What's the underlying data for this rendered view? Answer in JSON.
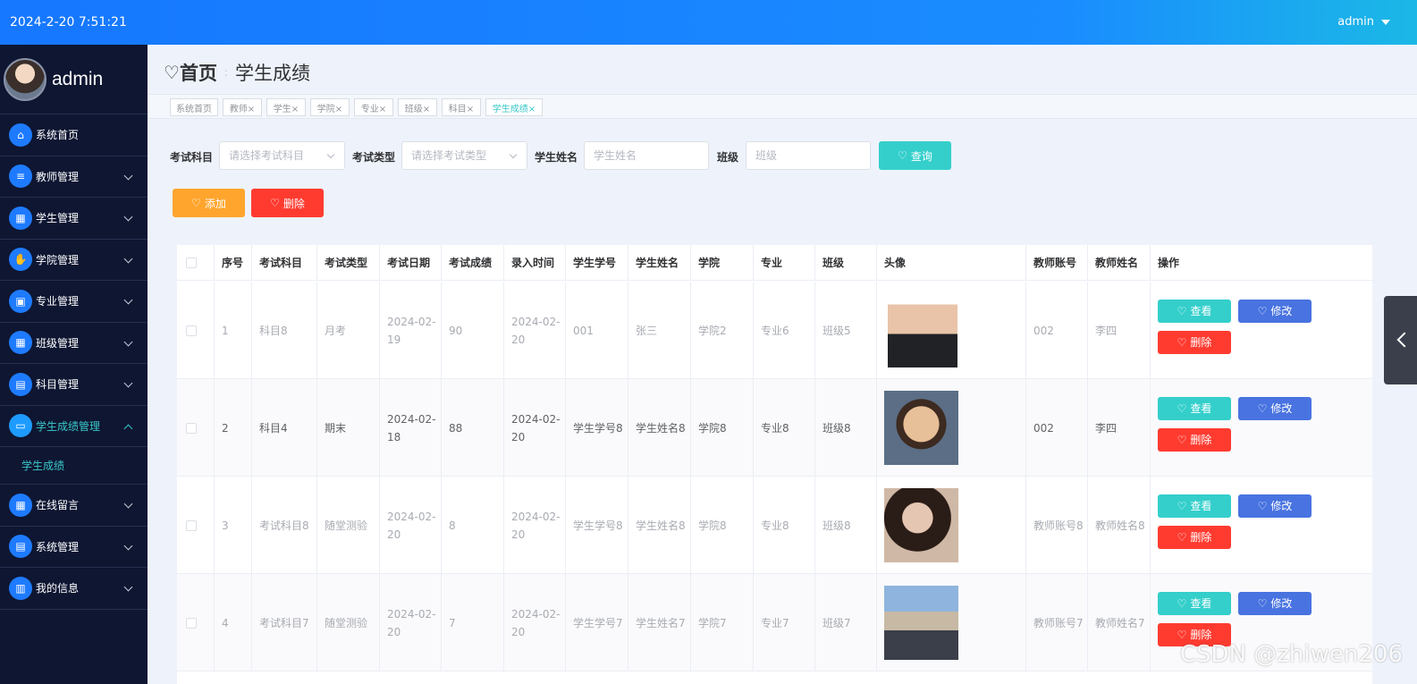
{
  "header": {
    "datetime": "2024-2-20 7:51:21",
    "user": "admin"
  },
  "sidebar": {
    "username": "admin",
    "items": [
      {
        "label": "系统首页",
        "icon": "home-icon",
        "glyph": "⌂"
      },
      {
        "label": "教师管理",
        "icon": "sliders-icon",
        "glyph": "≡"
      },
      {
        "label": "学生管理",
        "icon": "grid-icon",
        "glyph": "▦"
      },
      {
        "label": "学院管理",
        "icon": "thumb-icon",
        "glyph": "✋"
      },
      {
        "label": "专业管理",
        "icon": "badge-icon",
        "glyph": "▣"
      },
      {
        "label": "班级管理",
        "icon": "grid-icon",
        "glyph": "▦"
      },
      {
        "label": "科目管理",
        "icon": "clipboard-icon",
        "glyph": "▤"
      },
      {
        "label": "学生成绩管理",
        "icon": "monitor-icon",
        "glyph": "▭"
      },
      {
        "label": "在线留言",
        "icon": "grid-icon",
        "glyph": "▦"
      },
      {
        "label": "系统管理",
        "icon": "clipboard-icon",
        "glyph": "▤"
      },
      {
        "label": "我的信息",
        "icon": "card-icon",
        "glyph": "▥"
      }
    ],
    "submenu": "学生成绩"
  },
  "breadcrumb": {
    "home": "首页",
    "current": "学生成绩"
  },
  "tags": [
    "系统首页",
    "教师×",
    "学生×",
    "学院×",
    "专业×",
    "班级×",
    "科目×",
    "学生成绩×"
  ],
  "filters": {
    "subject_label": "考试科目",
    "subject_placeholder": "请选择考试科目",
    "type_label": "考试类型",
    "type_placeholder": "请选择考试类型",
    "name_label": "学生姓名",
    "name_placeholder": "学生姓名",
    "class_label": "班级",
    "class_placeholder": "班级",
    "query": "查询"
  },
  "actions": {
    "add": "添加",
    "delete": "删除"
  },
  "table": {
    "columns": [
      "序号",
      "考试科目",
      "考试类型",
      "考试日期",
      "考试成绩",
      "录入时间",
      "学生学号",
      "学生姓名",
      "学院",
      "专业",
      "班级",
      "头像",
      "教师账号",
      "教师姓名",
      "操作"
    ],
    "rows": [
      {
        "no": "1",
        "subject": "科目8",
        "type": "月考",
        "date": "2024-02-19",
        "score": "90",
        "entry": "2024-02-20",
        "sid": "001",
        "sname": "张三",
        "college": "学院2",
        "major": "专业6",
        "cls": "班级5",
        "tid": "002",
        "tname": "李四"
      },
      {
        "no": "2",
        "subject": "科目4",
        "type": "期末",
        "date": "2024-02-18",
        "score": "88",
        "entry": "2024-02-20",
        "sid": "学生学号8",
        "sname": "学生姓名8",
        "college": "学院8",
        "major": "专业8",
        "cls": "班级8",
        "tid": "002",
        "tname": "李四"
      },
      {
        "no": "3",
        "subject": "考试科目8",
        "type": "随堂测验",
        "date": "2024-02-20",
        "score": "8",
        "entry": "2024-02-20",
        "sid": "学生学号8",
        "sname": "学生姓名8",
        "college": "学院8",
        "major": "专业8",
        "cls": "班级8",
        "tid": "教师账号8",
        "tname": "教师姓名8"
      },
      {
        "no": "4",
        "subject": "考试科目7",
        "type": "随堂测验",
        "date": "2024-02-20",
        "score": "7",
        "entry": "2024-02-20",
        "sid": "学生学号7",
        "sname": "学生姓名7",
        "college": "学院7",
        "major": "专业7",
        "cls": "班级7",
        "tid": "教师账号7",
        "tname": "教师姓名7"
      }
    ],
    "ops": {
      "view": "查看",
      "edit": "修改",
      "delete": "删除"
    }
  },
  "watermark": "CSDN @zhiwen206",
  "colors": {
    "primary": "#1677ff",
    "teal": "#34cfcb",
    "orange": "#ffa52e",
    "red": "#ff3b30",
    "blue": "#4873e0",
    "sidebar": "#0e1632"
  }
}
